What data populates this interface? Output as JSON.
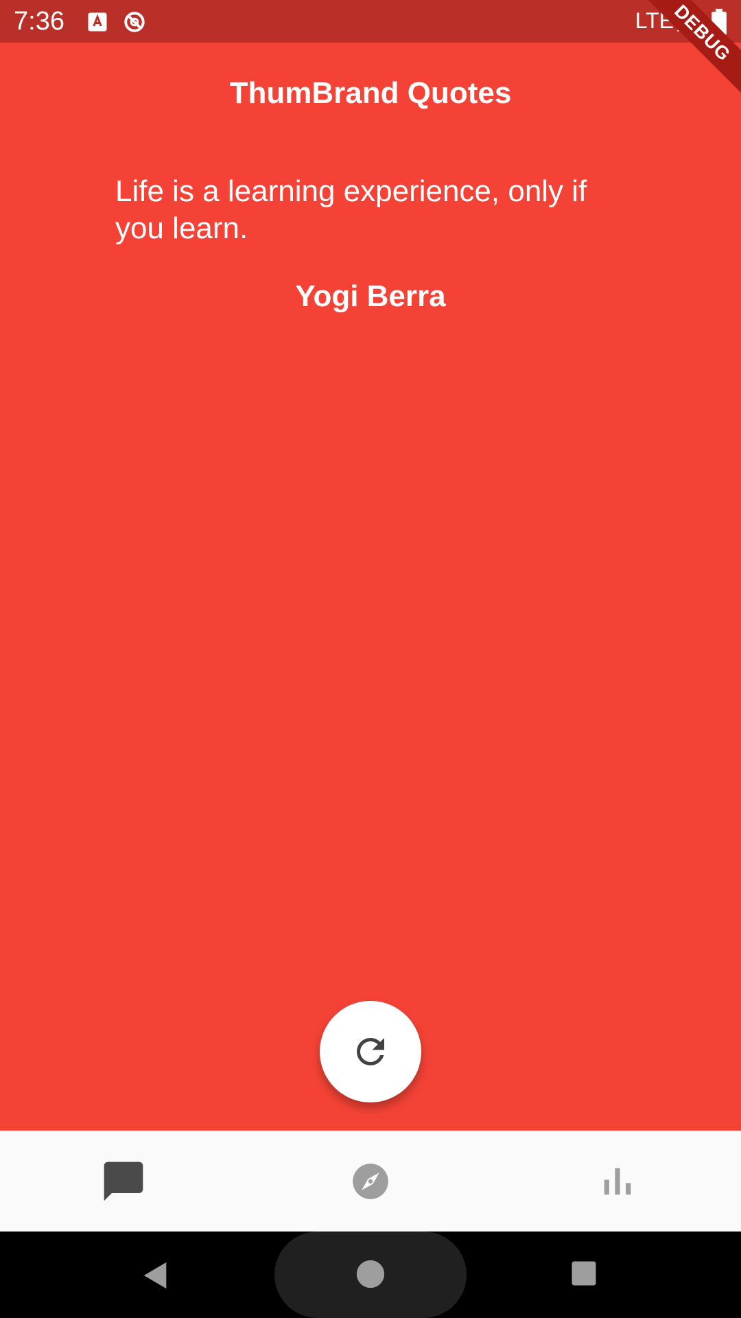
{
  "status_bar": {
    "time": "7:36",
    "network": "LTE",
    "icons": [
      "keyboard-a-icon",
      "sync-icon",
      "signal-icon",
      "battery-icon"
    ]
  },
  "debug_banner": "DEBUG",
  "app": {
    "title": "ThumBrand Quotes",
    "background_color": "#f44336"
  },
  "quote": {
    "text": "Life is a learning experience, only if you learn.",
    "author": "Yogi Berra"
  },
  "fab": {
    "icon": "refresh-icon"
  },
  "bottom_nav": {
    "items": [
      {
        "icon": "chat-bubble-icon",
        "active": true
      },
      {
        "icon": "compass-icon",
        "active": false
      },
      {
        "icon": "bar-chart-icon",
        "active": false
      }
    ]
  },
  "system_nav": {
    "buttons": [
      "back-icon",
      "home-icon",
      "recents-icon"
    ]
  }
}
